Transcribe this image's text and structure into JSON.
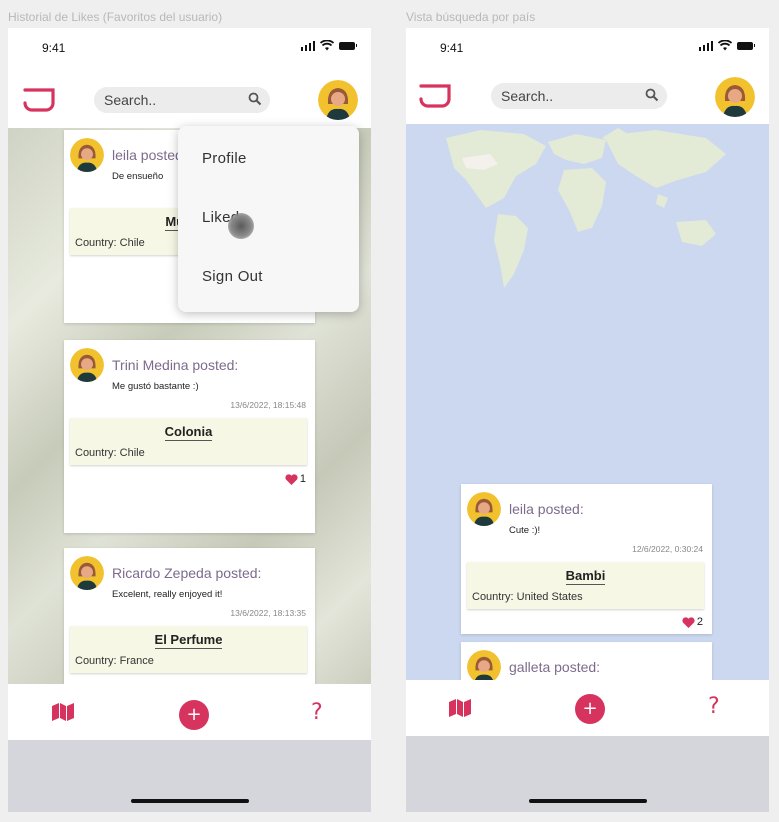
{
  "frames": {
    "left_title": "Historial de Likes (Favoritos del usuario)",
    "right_title": "Vista búsqueda por país"
  },
  "status_bar": {
    "time": "9:41"
  },
  "search": {
    "placeholder": "Search.."
  },
  "menu": {
    "items": [
      "Profile",
      "Liked",
      "Sign Out"
    ]
  },
  "left_feed": [
    {
      "poster": "leila posted:",
      "comment": "De ensueño",
      "timestamp": "",
      "item_name": "Mujer F",
      "country": "Country: Chile",
      "likes": ""
    },
    {
      "poster": "Trini Medina posted:",
      "comment": "Me gustó bastante :)",
      "timestamp": "13/6/2022, 18:15:48",
      "item_name": "Colonia",
      "country": "Country: Chile",
      "likes": "1"
    },
    {
      "poster": "Ricardo Zepeda posted:",
      "comment": "Excelent, really enjoyed it!",
      "timestamp": "13/6/2022, 18:13:35",
      "item_name": "El Perfume",
      "country": "Country: France",
      "likes": ""
    }
  ],
  "right_feed": [
    {
      "poster": "leila posted:",
      "comment": "Cute :)!",
      "timestamp": "12/6/2022, 0:30:24",
      "item_name": "Bambi",
      "country": "Country: United States",
      "likes": "2"
    },
    {
      "poster": "galleta posted:"
    }
  ],
  "icons": {
    "logo": "logo-icon",
    "search": "search-icon",
    "map": "map-icon",
    "add": "plus-icon",
    "help": "help-icon",
    "heart": "heart-icon"
  },
  "nav": {
    "add_glyph": "+",
    "help_glyph": "?"
  },
  "colors": {
    "accent": "#d6335e",
    "poster": "#7d6b8c",
    "item_bg": "#f7f7e6",
    "map_water": "#cbd8f0",
    "map_land": "#e4ecd8"
  }
}
